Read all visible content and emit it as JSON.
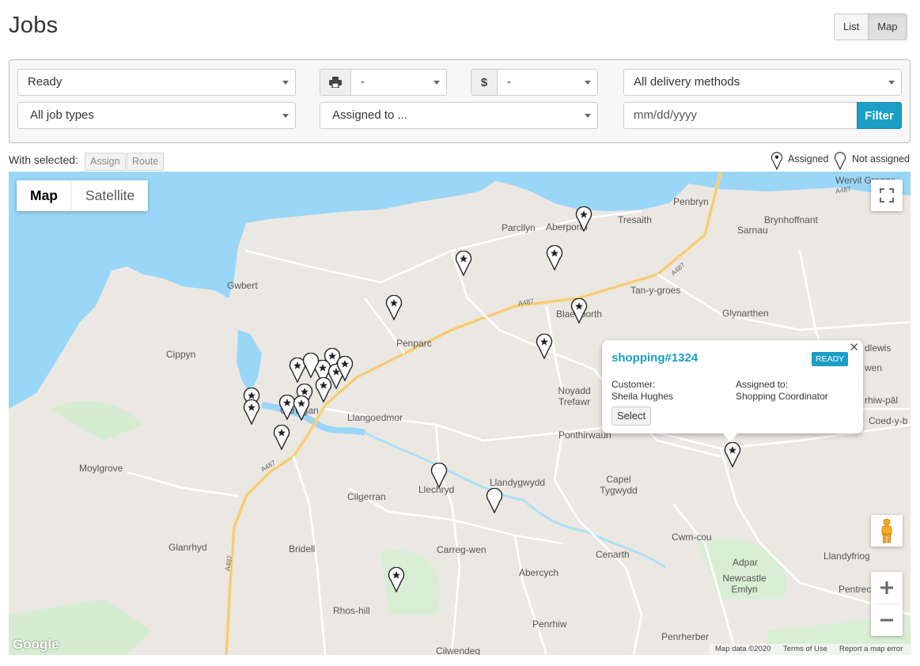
{
  "page": {
    "title": "Jobs"
  },
  "view_toggle": {
    "list_label": "List",
    "map_label": "Map",
    "active": "Map"
  },
  "filters": {
    "status": "Ready",
    "print_value": "-",
    "payment_value": "-",
    "delivery_method": "All delivery methods",
    "job_type": "All job types",
    "assigned_to": "Assigned to ...",
    "date_placeholder": "mm/dd/yyyy",
    "filter_button": "Filter",
    "print_icon": "printer-icon",
    "payment_icon": "dollar-icon"
  },
  "selection": {
    "label": "With selected:",
    "assign_button": "Assign",
    "route_button": "Route"
  },
  "legend": {
    "assigned": "Assigned",
    "not_assigned": "Not assigned"
  },
  "map": {
    "type_map": "Map",
    "type_satellite": "Satellite",
    "place_names": [
      "Wervil Grange",
      "Penbryn",
      "Parcllyn",
      "Aberporth",
      "Tresaith",
      "Brynhoffnant",
      "Sarnau",
      "Gwbert",
      "Tan-y-groes",
      "Glynarthen",
      "Blaenporth",
      "Penparc",
      "Cippyn",
      "dlewis",
      "wen",
      "rhiw-pâl",
      "Coed-y-b",
      "Noyadd Trefawr",
      "Cardigan",
      "Llangoedmor",
      "Ponthirwaun",
      "Moylgrove",
      "Llandygwydd",
      "Capel Tygwydd",
      "Llechryd",
      "Cilgerran",
      "Cwm-cou",
      "Glanrhyd",
      "Bridell",
      "Carreg-wen",
      "Cenarth",
      "Adpar",
      "Llandyfriog",
      "Abercych",
      "Newcastle Emlyn",
      "Pentrecagal",
      "Rhos-hill",
      "Penrhiw",
      "Penrherber",
      "Cilwendeg"
    ],
    "road_labels": [
      "A487",
      "A487",
      "A487",
      "A487",
      "A487"
    ],
    "fullscreen_icon": "fullscreen-icon",
    "pegman_icon": "pegman-icon",
    "zoom_in_icon": "plus-icon",
    "zoom_out_icon": "minus-icon",
    "logo_text": "Google",
    "attribution": {
      "data": "Map data ©2020",
      "terms": "Terms of Use",
      "report": "Report a map error"
    }
  },
  "popup": {
    "job_id": "shopping#1324",
    "status_badge": "READY",
    "customer_label": "Customer:",
    "customer_name": "Sheila Hughes",
    "assigned_label": "Assigned to:",
    "assigned_name": "Shopping Coordinator",
    "select_button": "Select",
    "close_icon": "close-icon"
  },
  "colors": {
    "accent": "#1a9fc6",
    "water": "#9ad6f7",
    "land": "#ebe8e3",
    "park": "#cbe9c8",
    "major_road": "#fbd685"
  }
}
